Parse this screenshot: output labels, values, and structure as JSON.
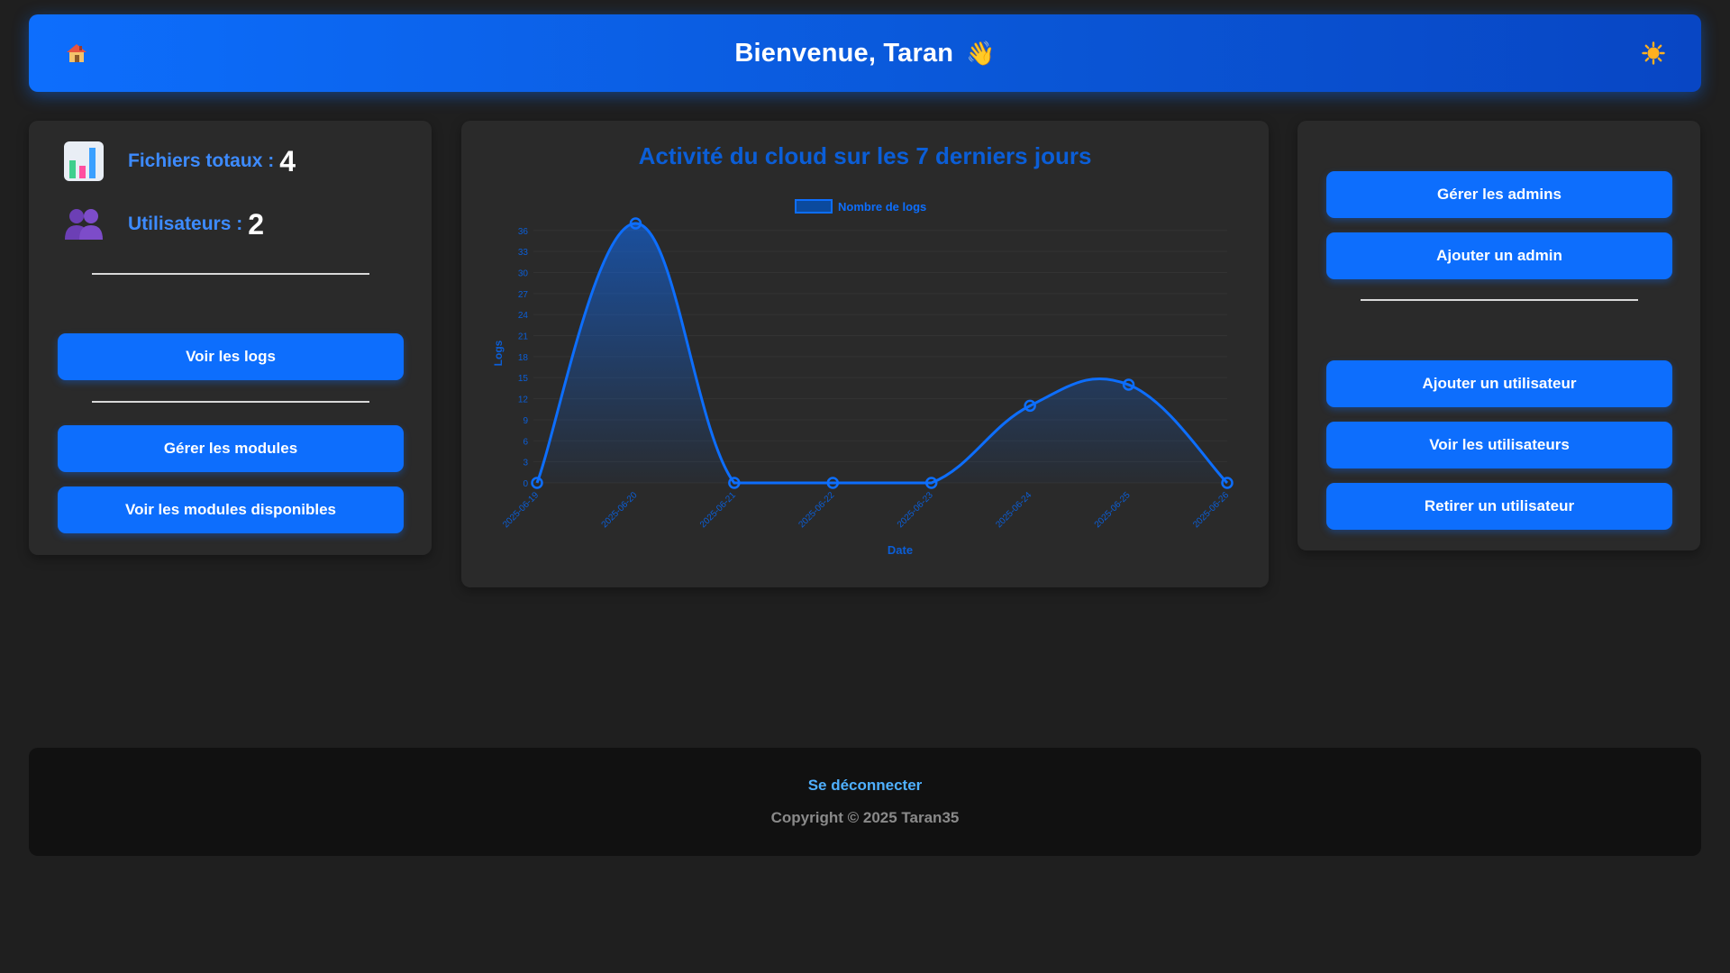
{
  "header": {
    "title": "Bienvenue, Taran",
    "wave_icon": "waving-hand-icon",
    "home_icon": "house-icon",
    "theme_icon": "sun-icon"
  },
  "stats": {
    "files_label": "Fichiers totaux :",
    "files_value": "4",
    "files_icon": "bar-chart-icon",
    "users_label": "Utilisateurs :",
    "users_value": "2",
    "users_icon": "users-icon"
  },
  "left_actions": {
    "view_logs": "Voir les logs",
    "manage_modules": "Gérer les modules",
    "available_modules": "Voir les modules disponibles"
  },
  "right_actions": {
    "manage_admins": "Gérer les admins",
    "add_admin": "Ajouter un admin",
    "add_user": "Ajouter un utilisateur",
    "view_users": "Voir les utilisateurs",
    "remove_user": "Retirer un utilisateur"
  },
  "chart_data": {
    "type": "area",
    "title": "Activité du cloud sur les 7 derniers jours",
    "legend": "Nombre de logs",
    "xlabel": "Date",
    "ylabel": "Logs",
    "x": [
      "2025-06-19",
      "2025-06-20",
      "2025-06-21",
      "2025-06-22",
      "2025-06-23",
      "2025-06-24",
      "2025-06-25",
      "2025-06-26"
    ],
    "values": [
      0,
      38,
      0,
      0,
      0,
      11,
      14,
      0
    ],
    "yticks": [
      0,
      3,
      6,
      9,
      12,
      15,
      18,
      21,
      24,
      27,
      30,
      33,
      36
    ],
    "ylim": [
      0,
      37
    ],
    "color": "#0d6efd"
  },
  "footer": {
    "logout": "Se déconnecter",
    "copyright": "Copyright © 2025 Taran35"
  }
}
